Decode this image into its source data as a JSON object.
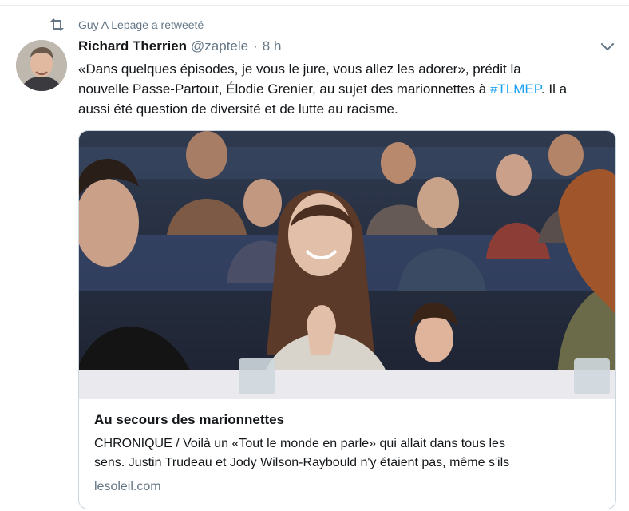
{
  "retweet": {
    "label": "Guy A Lepage a retweeté"
  },
  "tweet": {
    "author_name": "Richard Therrien",
    "author_handle": "@zaptele",
    "separator": "·",
    "time": "8 h",
    "text_lines": [
      {
        "before": "«Dans quelques épisodes, je vous le jure, vous allez les adorer», prédit la",
        "hashtag": "",
        "after": ""
      },
      {
        "before": "nouvelle Passe-Partout, Élodie Grenier, au sujet des marionnettes à ",
        "hashtag": "#TLMEP",
        "after": ". Il a"
      },
      {
        "before": "aussi été question de diversité et de lutte au racisme.",
        "hashtag": "",
        "after": ""
      }
    ]
  },
  "card": {
    "title": "Au secours des marionnettes",
    "description_lines": [
      "CHRONIQUE / Voilà un «Tout le monde en parle» qui allait dans tous les",
      "sens. Justin Trudeau et Jody Wilson-Raybould n'y étaient pas, même s'ils"
    ],
    "domain": "lesoleil.com"
  },
  "colors": {
    "accent": "#1da1f2",
    "secondary_text": "#657786",
    "border": "#ccd6dd"
  },
  "icons": {
    "retweet": "retweet-icon",
    "caret": "chevron-down-icon"
  }
}
